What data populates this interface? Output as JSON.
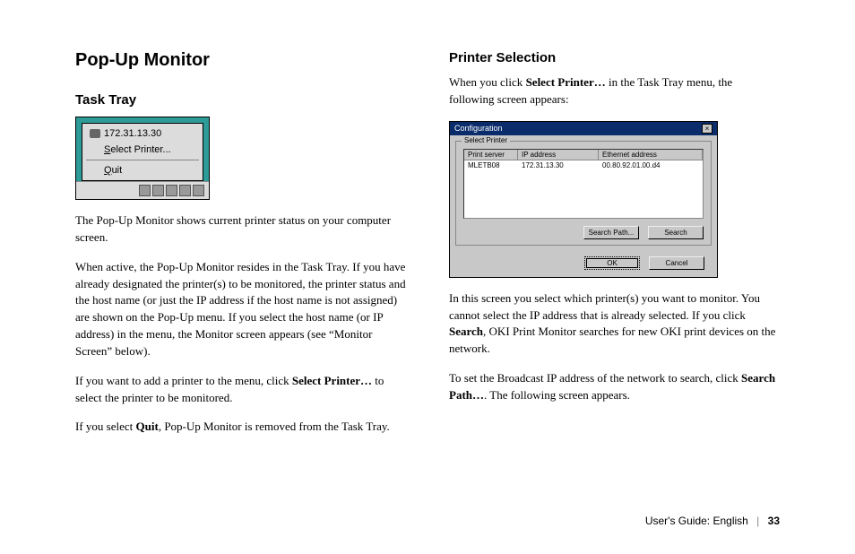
{
  "left": {
    "h1": "Pop-Up Monitor",
    "h2": "Task Tray",
    "tasktray": {
      "ip": "172.31.13.30",
      "select": "Select Printer...",
      "select_ul": "S",
      "quit": "Quit",
      "quit_ul": "Q"
    },
    "p1": "The Pop-Up Monitor shows current printer status on your computer screen.",
    "p2": "When active, the Pop-Up Monitor resides in the Task Tray. If you have already designated the printer(s) to be monitored, the printer status and the host name (or just the IP address if the host name is not assigned) are shown on the Pop-Up menu. If you select the host name (or IP address) in the menu, the Monitor screen appears (see “Monitor Screen” below).",
    "p3a": "If you want to add a printer to the menu, click ",
    "p3b": "Select Printer…",
    "p3c": " to select the printer to be monitored.",
    "p4a": "If you select ",
    "p4b": "Quit",
    "p4c": ", Pop-Up Monitor is removed from the Task Tray."
  },
  "right": {
    "h2": "Printer Selection",
    "p1a": "When you click ",
    "p1b": "Select Printer…",
    "p1c": " in the Task Tray menu, the following screen appears:",
    "dialog": {
      "title": "Configuration",
      "group": "Select Printer",
      "col1": "Print server",
      "col2": "IP address",
      "col3": "Ethernet address",
      "row_server": "MLETB08",
      "row_ip": "172.31.13.30",
      "row_eth": "00.80.92.01.00.d4",
      "search_path": "Search Path...",
      "search": "Search",
      "ok": "OK",
      "cancel": "Cancel"
    },
    "p2a": "In this screen you select which printer(s) you want to monitor. You cannot select the IP address that is already selected.  If you click ",
    "p2b": "Search",
    "p2c": ", OKI Print Monitor searches for new OKI print devices on the network.",
    "p3a": "To set the Broadcast IP address of the network to search, click ",
    "p3b": "Search Path…",
    "p3c": ".  The following screen appears."
  },
  "footer": {
    "label": "User's Guide: English",
    "page": "33"
  }
}
